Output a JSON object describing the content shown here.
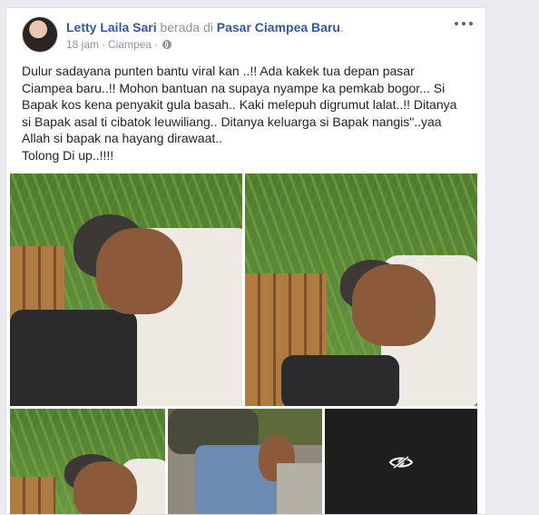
{
  "post": {
    "author": "Letty Laila Sari",
    "connector": " berada di ",
    "place": "Pasar Ciampea Baru",
    "place_suffix": ".",
    "time": "18 jam",
    "separator": "·",
    "location": "Ciampea",
    "privacy_icon": "globe-icon",
    "more_icon": "more-options-icon",
    "text_lines": [
      "Dulur sadayana punten bantu viral kan ..!! Ada kakek tua depan pasar",
      "Ciampea baru..!! Mohon bantuan na supaya nyampe ka pemkab bogor... Si",
      "Bapak kos kena penyakit gula basah.. Kaki melepuh digrumut lalat..!! Ditanya",
      "si Bapak asal ti cibatok leuwiliang.. Ditanya keluarga si Bapak nangis\"..yaa",
      "Allah si bapak na hayang dirawaat..",
      "Tolong Di up..!!!!"
    ]
  },
  "photos": {
    "count": 5,
    "hidden_photo_icon": "eye-icon"
  },
  "colors": {
    "link": "#365899",
    "muted": "#90949c",
    "background": "#e9ebee"
  }
}
